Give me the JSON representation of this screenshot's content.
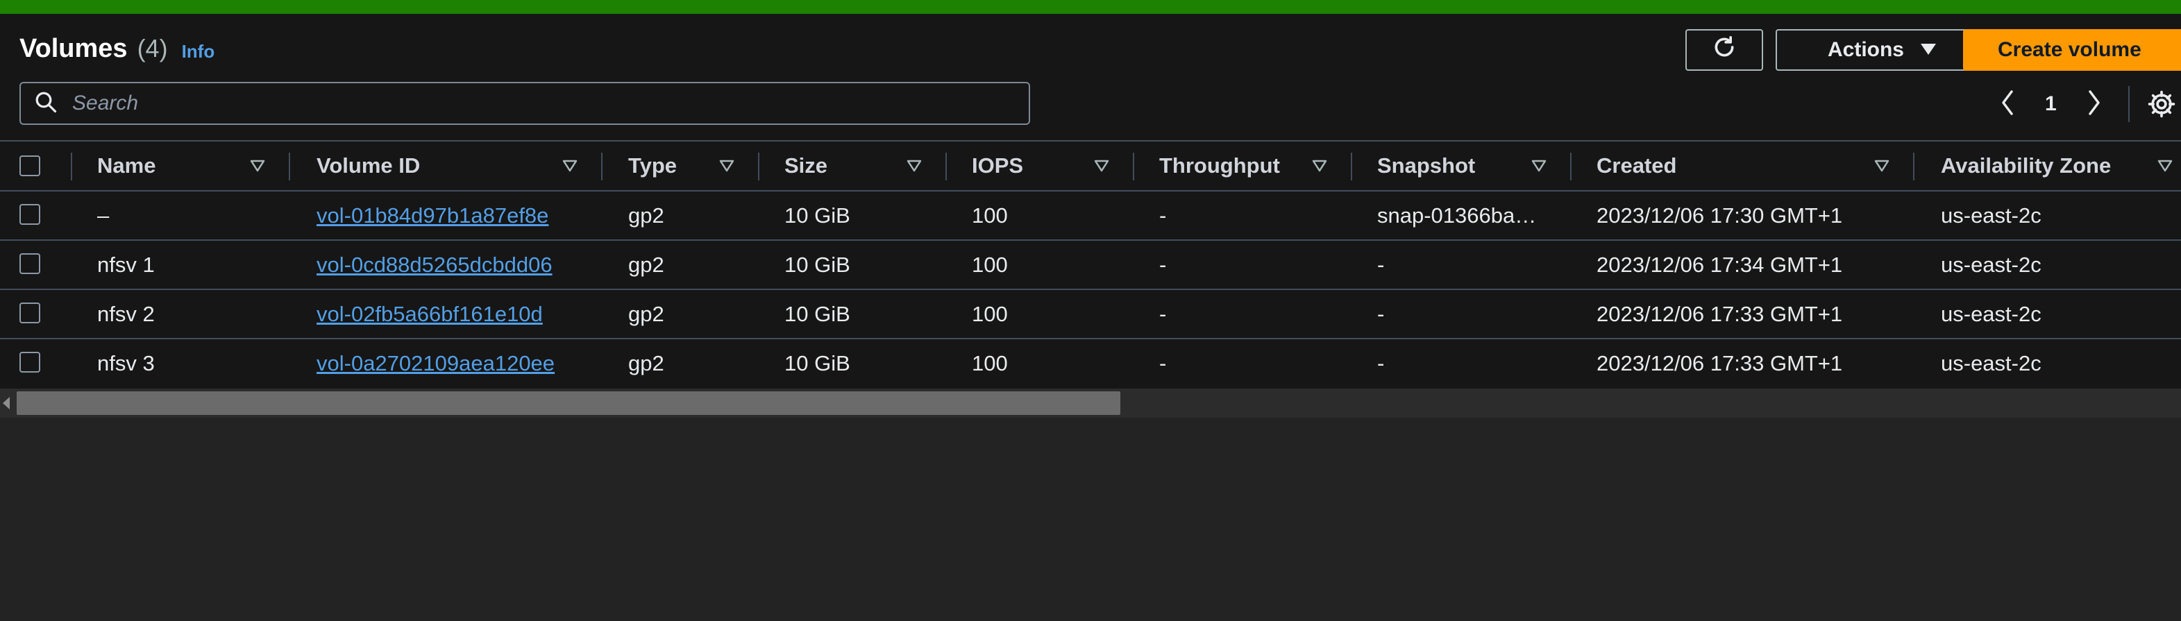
{
  "header": {
    "title": "Volumes",
    "count": "(4)",
    "info_link": "Info"
  },
  "toolbar": {
    "refresh_icon": "refresh-icon",
    "actions_label": "Actions",
    "create_label": "Create volume"
  },
  "search": {
    "placeholder": "Search",
    "value": ""
  },
  "pagination": {
    "current_page": "1"
  },
  "table": {
    "columns": [
      "Name",
      "Volume ID",
      "Type",
      "Size",
      "IOPS",
      "Throughput",
      "Snapshot",
      "Created",
      "Availability Zone"
    ],
    "rows": [
      {
        "name": "–",
        "volume_id": "vol-01b84d97b1a87ef8e",
        "type": "gp2",
        "size": "10 GiB",
        "iops": "100",
        "throughput": "-",
        "snapshot": "snap-01366ba…",
        "created": "2023/12/06 17:30 GMT+1",
        "az": "us-east-2c"
      },
      {
        "name": "nfsv 1",
        "volume_id": "vol-0cd88d5265dcbdd06",
        "type": "gp2",
        "size": "10 GiB",
        "iops": "100",
        "throughput": "-",
        "snapshot": "-",
        "created": "2023/12/06 17:34 GMT+1",
        "az": "us-east-2c"
      },
      {
        "name": "nfsv 2",
        "volume_id": "vol-02fb5a66bf161e10d",
        "type": "gp2",
        "size": "10 GiB",
        "iops": "100",
        "throughput": "-",
        "snapshot": "-",
        "created": "2023/12/06 17:33 GMT+1",
        "az": "us-east-2c"
      },
      {
        "name": "nfsv 3",
        "volume_id": "vol-0a2702109aea120ee",
        "type": "gp2",
        "size": "10 GiB",
        "iops": "100",
        "throughput": "-",
        "snapshot": "-",
        "created": "2023/12/06 17:33 GMT+1",
        "az": "us-east-2c"
      }
    ]
  },
  "colors": {
    "top_bar": "#1d8102",
    "primary_button": "#ff9900",
    "link": "#539fe5",
    "background": "#161616"
  }
}
